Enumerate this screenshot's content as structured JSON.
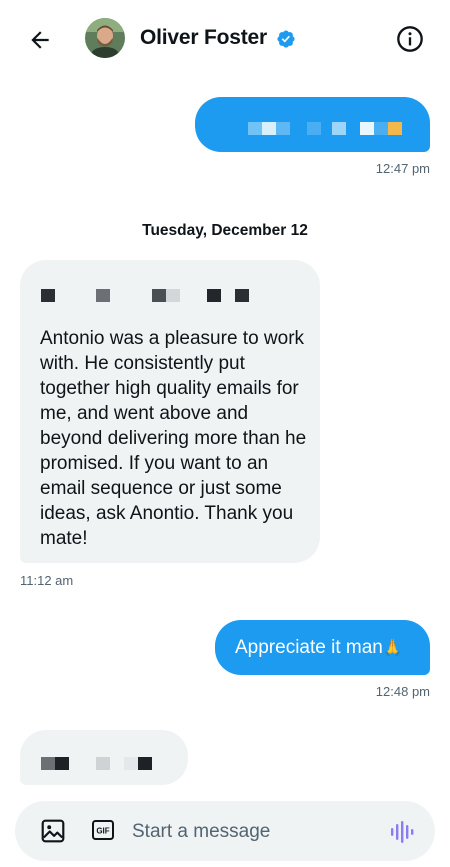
{
  "header": {
    "contact_name": "Oliver Foster",
    "verified": true
  },
  "conversation": {
    "date_separator": "Tuesday, December 12",
    "messages": [
      {
        "direction": "outgoing",
        "text": "",
        "redacted": true,
        "time": "12:47 pm"
      },
      {
        "direction": "incoming",
        "text": "Antonio was a pleasure to work with. He consistently put together high quality emails for me, and went above and beyond delivering more than he promised. If you want to an email sequence or just some ideas, ask Anontio. Thank you mate!",
        "redacted_prefix": true,
        "time": "11:12 am"
      },
      {
        "direction": "outgoing",
        "text": "Appreciate it man",
        "emoji": "🙏",
        "time": "12:48 pm"
      },
      {
        "direction": "incoming",
        "text": "",
        "redacted": true
      }
    ]
  },
  "composer": {
    "placeholder": "Start a message",
    "gif_label": "GIF"
  },
  "colors": {
    "accent": "#1d9bf0",
    "incoming_bubble": "#eff3f4",
    "secondary_text": "#536471",
    "voice_icon": "#8b7cf6"
  }
}
